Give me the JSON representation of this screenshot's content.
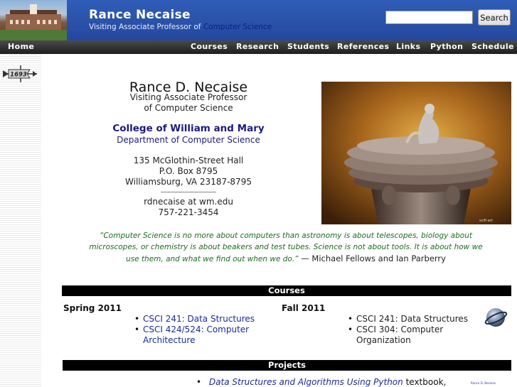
{
  "header": {
    "title": "Rance Necaise",
    "subtitle_prefix": "Visiting Associate Professor of ",
    "subtitle_link": "Computer Science",
    "search_button": "Search",
    "search_value": ""
  },
  "nav": {
    "home": "Home",
    "items": [
      "Courses",
      "Research",
      "Students",
      "References",
      "Links",
      "Python",
      "Schedule"
    ]
  },
  "sidebar": {
    "weathervane_year": "1693"
  },
  "contact": {
    "name": "Rance D. Necaise",
    "title_line1": "Visiting Associate Professor",
    "title_line2": "of Computer Science",
    "college": "College of William and Mary",
    "department": "Department of Computer Science",
    "address1": "135 McGlothin-Street Hall",
    "address2": "P.O. Box 8795",
    "address3": "Williamsburg, VA 23187-8795",
    "email": "rdnecaise at wm.edu",
    "phone": "757-221-3454"
  },
  "image": {
    "caption": "scifi-art"
  },
  "quote": {
    "text": "“Computer Science is no more about computers than astronomy is about telescopes, biology about microscopes, or chemistry is about beakers and test tubes. Science is not about tools. It is about how we use them, and what we find out when we do.”",
    "attribution": " — Michael Fellows and Ian Parberry"
  },
  "courses": {
    "header": "Courses",
    "spring": {
      "term": "Spring 2011",
      "items": [
        "CSCI 241: Data Structures",
        "CSCI 424/524: Computer Architecture"
      ]
    },
    "fall": {
      "term": "Fall 2011",
      "items": [
        "CSCI 241: Data Structures",
        "CSCI 304: Computer Organization"
      ]
    }
  },
  "projects": {
    "header": "Projects",
    "item_link": "Data Structures and Algorithms Using Python",
    "item_text": " textbook,",
    "small_link": "Rance D. Necaise"
  }
}
